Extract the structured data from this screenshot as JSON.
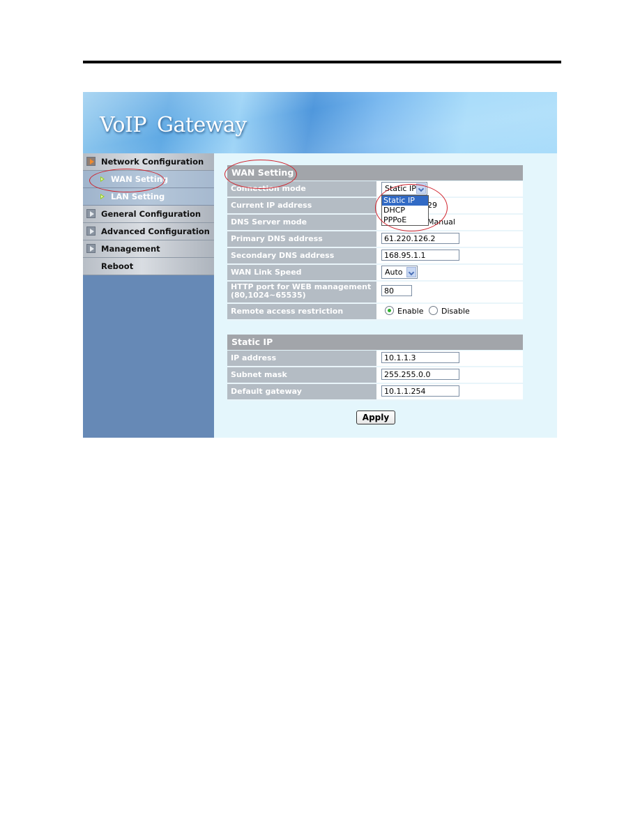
{
  "banner": {
    "title": "VoIP Gateway"
  },
  "sidebar": {
    "items": [
      {
        "label": "Network Configuration",
        "expanded": true,
        "children": [
          {
            "label": "WAN Setting",
            "selected": true
          },
          {
            "label": "LAN Setting"
          }
        ]
      },
      {
        "label": "General Configuration"
      },
      {
        "label": "Advanced Configuration"
      },
      {
        "label": "Management"
      },
      {
        "label": "Reboot"
      }
    ]
  },
  "wan": {
    "title": "WAN Setting",
    "connection_mode": {
      "label": "Connection mode",
      "value": "Static IP",
      "options": [
        "Static IP",
        "DHCP",
        "PPPoE"
      ],
      "highlighted": "Static IP"
    },
    "current_ip": {
      "label": "Current IP address",
      "value_visible": "29"
    },
    "dns_mode": {
      "label": "DNS Server mode",
      "value_visible": "Manual"
    },
    "primary_dns": {
      "label": "Primary DNS address",
      "value": "61.220.126.2"
    },
    "secondary_dns": {
      "label": "Secondary DNS address",
      "value": "168.95.1.1"
    },
    "link_speed": {
      "label": "WAN Link Speed",
      "value": "Auto"
    },
    "http_port": {
      "label_line1": "HTTP port for WEB management",
      "label_line2": "(80,1024~65535)",
      "value": "80"
    },
    "remote_access": {
      "label": "Remote access restriction",
      "options": [
        "Enable",
        "Disable"
      ],
      "selected": "Enable"
    }
  },
  "static_ip": {
    "title": "Static IP",
    "ip": {
      "label": "IP address",
      "value": "10.1.1.3"
    },
    "mask": {
      "label": "Subnet mask",
      "value": "255.255.0.0"
    },
    "gateway": {
      "label": "Default gateway",
      "value": "10.1.1.254"
    }
  },
  "actions": {
    "apply_label": "Apply"
  },
  "annotations": {
    "color": "#d0202a"
  }
}
